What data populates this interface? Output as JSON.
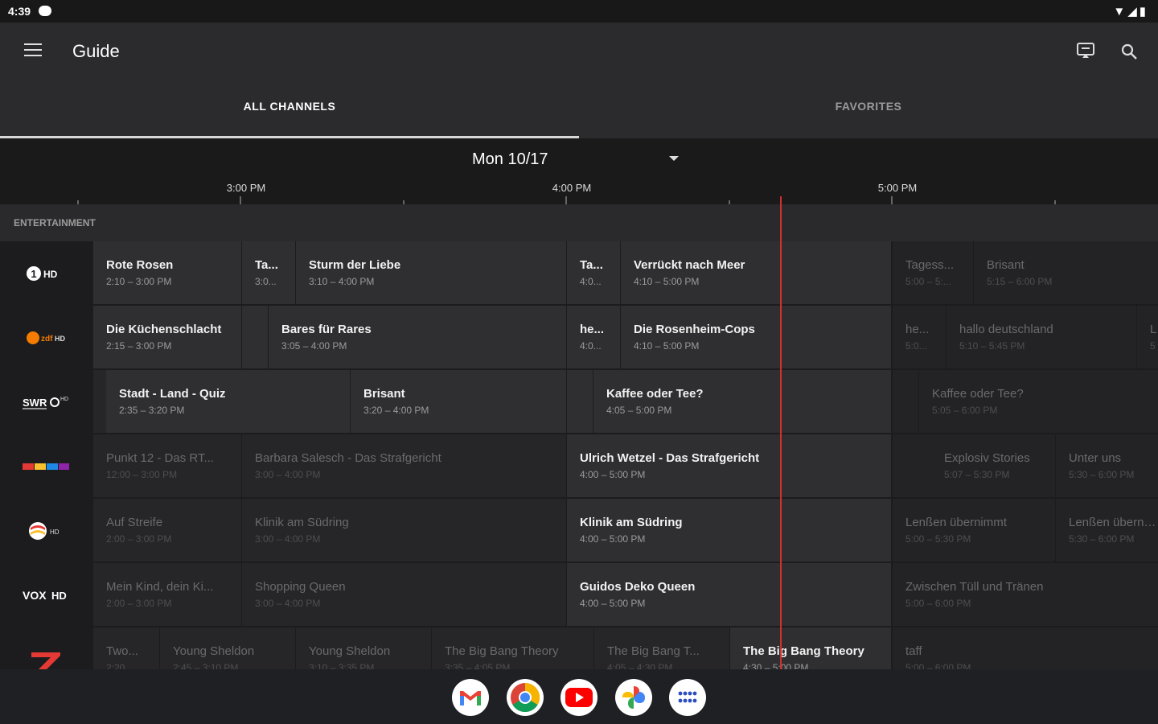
{
  "status": {
    "time": "4:39",
    "indicators": "▼◢▮"
  },
  "app": {
    "title": "Guide"
  },
  "tabs": [
    {
      "label": "ALL CHANNELS",
      "selected": true
    },
    {
      "label": "FAVORITES",
      "selected": false
    }
  ],
  "date": {
    "label": "Mon 10/17"
  },
  "timeline": {
    "labels": [
      "3:00 PM",
      "4:00 PM",
      "5:00 PM"
    ]
  },
  "section": {
    "label": "ENTERTAINMENT"
  },
  "channels": [
    {
      "logo": "ARD HD",
      "programs": [
        {
          "title": "Rote Rosen",
          "time": "2:10 – 3:00 PM"
        },
        {
          "title": "Ta...",
          "time": "3:0..."
        },
        {
          "title": "Sturm der Liebe",
          "time": "3:10 – 4:00 PM"
        },
        {
          "title": "Ta...",
          "time": "4:0..."
        },
        {
          "title": "Verrückt nach Meer",
          "time": "4:10 – 5:00 PM"
        },
        {
          "title": "Tagess...",
          "time": "5:00 – 5:..."
        },
        {
          "title": "Brisant",
          "time": "5:15 – 6:00 PM"
        }
      ]
    },
    {
      "logo": "ZDF HD",
      "programs": [
        {
          "title": "Die Küchenschlacht",
          "time": "2:15 – 3:00 PM"
        },
        {
          "title": "Bares für Rares",
          "time": "3:05 – 4:00 PM"
        },
        {
          "title": "he...",
          "time": "4:0..."
        },
        {
          "title": "Die Rosenheim-Cops",
          "time": "4:10 – 5:00 PM"
        },
        {
          "title": "he...",
          "time": "5:0..."
        },
        {
          "title": "hallo deutschland",
          "time": "5:10 – 5:45 PM"
        },
        {
          "title": "L",
          "time": "5"
        }
      ]
    },
    {
      "logo": "SWR HD",
      "programs": [
        {
          "title": "Stadt - Land - Quiz",
          "time": "2:35 – 3:20 PM"
        },
        {
          "title": "Brisant",
          "time": "3:20 – 4:00 PM"
        },
        {
          "title": "Kaffee oder Tee?",
          "time": "4:05 – 5:00 PM"
        },
        {
          "title": "Kaffee oder Tee?",
          "time": "5:05 – 6:00 PM"
        }
      ]
    },
    {
      "logo": "RTL",
      "programs": [
        {
          "title": "Punkt 12 - Das RT...",
          "time": "12:00 – 3:00 PM"
        },
        {
          "title": "Barbara Salesch - Das Strafgericht",
          "time": "3:00 – 4:00 PM"
        },
        {
          "title": "Ulrich Wetzel - Das Strafgericht",
          "time": "4:00 – 5:00 PM"
        },
        {
          "title": "Explosiv Stories",
          "time": "5:07 – 5:30 PM"
        },
        {
          "title": "Unter uns",
          "time": "5:30 – 6:00 PM"
        }
      ]
    },
    {
      "logo": "SAT.1 HD",
      "programs": [
        {
          "title": "Auf Streife",
          "time": "2:00 – 3:00 PM"
        },
        {
          "title": "Klinik am Südring",
          "time": "3:00 – 4:00 PM"
        },
        {
          "title": "Klinik am Südring",
          "time": "4:00 – 5:00 PM"
        },
        {
          "title": "Lenßen übernimmt",
          "time": "5:00 – 5:30 PM"
        },
        {
          "title": "Lenßen übernimmt",
          "time": "5:30 – 6:00 PM"
        }
      ]
    },
    {
      "logo": "VOX HD",
      "programs": [
        {
          "title": "Mein Kind, dein Ki...",
          "time": "2:00 – 3:00 PM"
        },
        {
          "title": "Shopping Queen",
          "time": "3:00 – 4:00 PM"
        },
        {
          "title": "Guidos Deko Queen",
          "time": "4:00 – 5:00 PM"
        },
        {
          "title": "Zwischen Tüll und Tränen",
          "time": "5:00 – 6:00 PM"
        }
      ]
    },
    {
      "logo": "ProSieben",
      "programs": [
        {
          "title": "Two...",
          "time": "2:20"
        },
        {
          "title": "Young Sheldon",
          "time": "2:45 – 3:10 PM"
        },
        {
          "title": "Young Sheldon",
          "time": "3:10 – 3:35 PM"
        },
        {
          "title": "The Big Bang Theory",
          "time": "3:35 – 4:05 PM"
        },
        {
          "title": "The Big Bang T...",
          "time": "4:05 – 4:30 PM"
        },
        {
          "title": "The Big Bang Theory",
          "time": "4:30 – 5:00 PM"
        },
        {
          "title": "taff",
          "time": "5:00 – 6:00 PM"
        }
      ]
    }
  ],
  "dock": {
    "apps": [
      "Gmail",
      "Chrome",
      "YouTube",
      "Photos",
      "App drawer"
    ]
  },
  "colors": {
    "accent_now_line": "#d32f2f",
    "background": "#1c1c1e",
    "appbar": "#2b2b2d"
  }
}
